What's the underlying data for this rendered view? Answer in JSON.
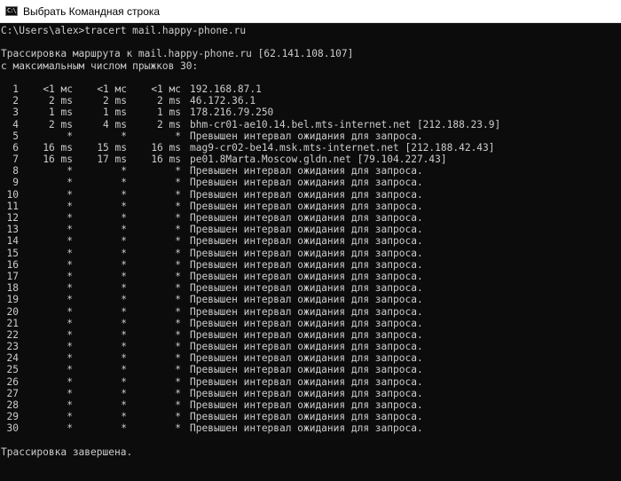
{
  "window": {
    "title": "Выбрать Командная строка",
    "icon": "console-icon",
    "icon_glyph": "C:\\"
  },
  "console": {
    "prompt_line": "C:\\Users\\alex>tracert mail.happy-phone.ru",
    "header_line1": "Трассировка маршрута к mail.happy-phone.ru [62.141.108.107]",
    "header_line2": "с максимальным числом прыжков 30:",
    "footer": "Трассировка завершена.",
    "hops": [
      {
        "n": "1",
        "t1": "<1 мс",
        "t2": "<1 мс",
        "t3": "<1 мс",
        "host": "192.168.87.1"
      },
      {
        "n": "2",
        "t1": "2 ms",
        "t2": "2 ms",
        "t3": "2 ms",
        "host": "46.172.36.1"
      },
      {
        "n": "3",
        "t1": "1 ms",
        "t2": "1 ms",
        "t3": "1 ms",
        "host": "178.216.79.250"
      },
      {
        "n": "4",
        "t1": "2 ms",
        "t2": "4 ms",
        "t3": "2 ms",
        "host": "bhm-cr01-ae10.14.bel.mts-internet.net [212.188.23.9]"
      },
      {
        "n": "5",
        "t1": "*",
        "t2": "*",
        "t3": "*",
        "host": "Превышен интервал ожидания для запроса."
      },
      {
        "n": "6",
        "t1": "16 ms",
        "t2": "15 ms",
        "t3": "16 ms",
        "host": "mag9-cr02-be14.msk.mts-internet.net [212.188.42.43]"
      },
      {
        "n": "7",
        "t1": "16 ms",
        "t2": "17 ms",
        "t3": "16 ms",
        "host": "pe01.8Marta.Moscow.gldn.net [79.104.227.43]"
      },
      {
        "n": "8",
        "t1": "*",
        "t2": "*",
        "t3": "*",
        "host": "Превышен интервал ожидания для запроса."
      },
      {
        "n": "9",
        "t1": "*",
        "t2": "*",
        "t3": "*",
        "host": "Превышен интервал ожидания для запроса."
      },
      {
        "n": "10",
        "t1": "*",
        "t2": "*",
        "t3": "*",
        "host": "Превышен интервал ожидания для запроса."
      },
      {
        "n": "11",
        "t1": "*",
        "t2": "*",
        "t3": "*",
        "host": "Превышен интервал ожидания для запроса."
      },
      {
        "n": "12",
        "t1": "*",
        "t2": "*",
        "t3": "*",
        "host": "Превышен интервал ожидания для запроса."
      },
      {
        "n": "13",
        "t1": "*",
        "t2": "*",
        "t3": "*",
        "host": "Превышен интервал ожидания для запроса."
      },
      {
        "n": "14",
        "t1": "*",
        "t2": "*",
        "t3": "*",
        "host": "Превышен интервал ожидания для запроса."
      },
      {
        "n": "15",
        "t1": "*",
        "t2": "*",
        "t3": "*",
        "host": "Превышен интервал ожидания для запроса."
      },
      {
        "n": "16",
        "t1": "*",
        "t2": "*",
        "t3": "*",
        "host": "Превышен интервал ожидания для запроса."
      },
      {
        "n": "17",
        "t1": "*",
        "t2": "*",
        "t3": "*",
        "host": "Превышен интервал ожидания для запроса."
      },
      {
        "n": "18",
        "t1": "*",
        "t2": "*",
        "t3": "*",
        "host": "Превышен интервал ожидания для запроса."
      },
      {
        "n": "19",
        "t1": "*",
        "t2": "*",
        "t3": "*",
        "host": "Превышен интервал ожидания для запроса."
      },
      {
        "n": "20",
        "t1": "*",
        "t2": "*",
        "t3": "*",
        "host": "Превышен интервал ожидания для запроса."
      },
      {
        "n": "21",
        "t1": "*",
        "t2": "*",
        "t3": "*",
        "host": "Превышен интервал ожидания для запроса."
      },
      {
        "n": "22",
        "t1": "*",
        "t2": "*",
        "t3": "*",
        "host": "Превышен интервал ожидания для запроса."
      },
      {
        "n": "23",
        "t1": "*",
        "t2": "*",
        "t3": "*",
        "host": "Превышен интервал ожидания для запроса."
      },
      {
        "n": "24",
        "t1": "*",
        "t2": "*",
        "t3": "*",
        "host": "Превышен интервал ожидания для запроса."
      },
      {
        "n": "25",
        "t1": "*",
        "t2": "*",
        "t3": "*",
        "host": "Превышен интервал ожидания для запроса."
      },
      {
        "n": "26",
        "t1": "*",
        "t2": "*",
        "t3": "*",
        "host": "Превышен интервал ожидания для запроса."
      },
      {
        "n": "27",
        "t1": "*",
        "t2": "*",
        "t3": "*",
        "host": "Превышен интервал ожидания для запроса."
      },
      {
        "n": "28",
        "t1": "*",
        "t2": "*",
        "t3": "*",
        "host": "Превышен интервал ожидания для запроса."
      },
      {
        "n": "29",
        "t1": "*",
        "t2": "*",
        "t3": "*",
        "host": "Превышен интервал ожидания для запроса."
      },
      {
        "n": "30",
        "t1": "*",
        "t2": "*",
        "t3": "*",
        "host": "Превышен интервал ожидания для запроса."
      }
    ]
  },
  "colors": {
    "console_bg": "#0c0c0c",
    "console_text": "#cccccc",
    "titlebar_bg": "#ffffff"
  }
}
